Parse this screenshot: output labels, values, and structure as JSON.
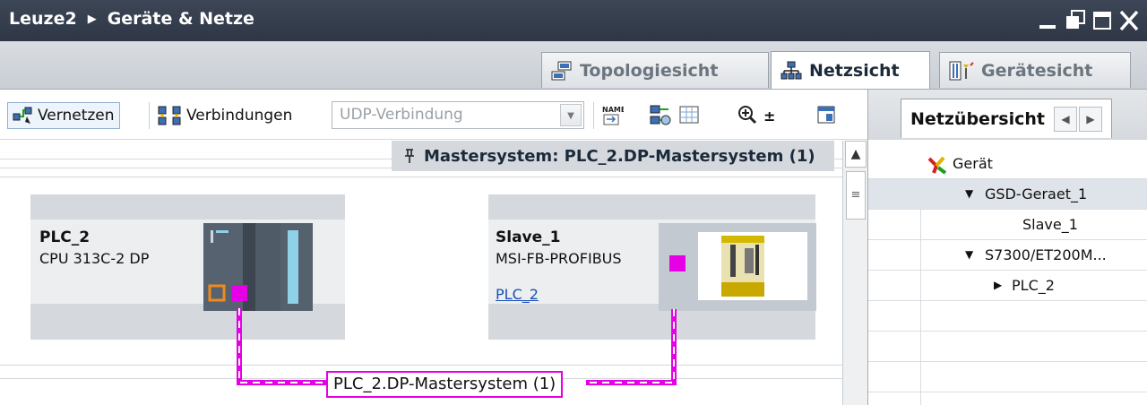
{
  "titlebar": {
    "project": "Leuze2",
    "separator": "▶",
    "section": "Geräte & Netze",
    "controls": [
      "▬",
      "❐",
      "▇",
      "✕"
    ]
  },
  "view_tabs": [
    {
      "label": "Topologiesicht",
      "icon": "topology-icon",
      "active": false
    },
    {
      "label": "Netzsicht",
      "icon": "network-icon",
      "active": true
    },
    {
      "label": "Gerätesicht",
      "icon": "device-view-icon",
      "active": false
    }
  ],
  "toolbar": {
    "network_label": "Vernetzen",
    "connections_label": "Verbindungen",
    "connection_type_value": "UDP-Verbindung",
    "zoom_label": "±"
  },
  "canvas": {
    "mastersystem_banner": "Mastersystem: PLC_2.DP-Mastersystem (1)",
    "devices": [
      {
        "name": "PLC_2",
        "type": "CPU 313C-2 DP",
        "link": ""
      },
      {
        "name": "Slave_1",
        "type": "MSI-FB-PROFIBUS",
        "link": "PLC_2"
      }
    ],
    "network_label": "PLC_2.DP-Mastersystem (1)",
    "network_color": "#e600e6"
  },
  "overview": {
    "tab_label": "Netzübersicht",
    "column_header": "Gerät",
    "rows": [
      {
        "label": "GSD-Geraet_1",
        "indent": 1,
        "toggle": "▼",
        "selected": true
      },
      {
        "label": "Slave_1",
        "indent": 2,
        "toggle": "",
        "selected": false
      },
      {
        "label": "S7300/ET200M...",
        "indent": 1,
        "toggle": "▼",
        "selected": false
      },
      {
        "label": "PLC_2",
        "indent": 2,
        "toggle": "▶",
        "selected": false
      }
    ]
  }
}
